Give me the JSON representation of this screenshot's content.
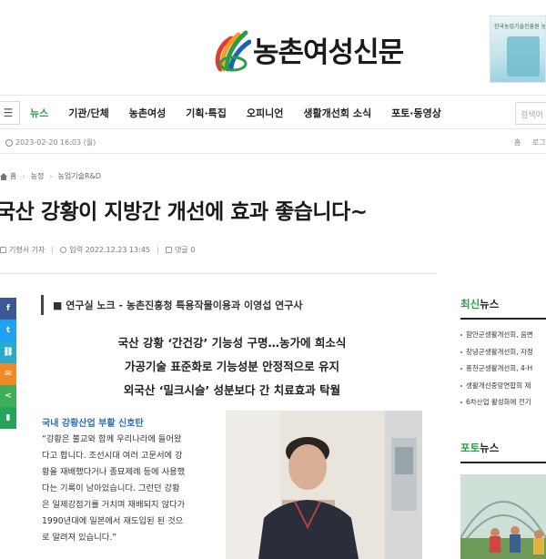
{
  "site": {
    "logo_text": "농촌여성신문"
  },
  "ad": {
    "text": "한국농업기술진흥원 농촌진흥"
  },
  "nav": {
    "menu_icon": "hamburger-icon",
    "items": [
      "뉴스",
      "기관/단체",
      "농촌여성",
      "기획·특집",
      "오피니언",
      "생활개선회 소식",
      "포토·동영상"
    ],
    "active": "뉴스",
    "search_placeholder": "검색어"
  },
  "datebar": {
    "date": "2023-02-20 16:03 (월)",
    "links": [
      "홈",
      "로그"
    ]
  },
  "breadcrumb": [
    "홈",
    "농정",
    "농업기술R&D"
  ],
  "article": {
    "headline": "국산 강황이 지방간 개선에 효과 좋습니다~",
    "reporter": "기형서 기자",
    "date": "입력 2022.12.23 13:45",
    "comments": "댓글 0",
    "subtitle": "■ 연구실 노크 - 농촌진흥청 특용작물이용과 이영섭 연구사",
    "leads": [
      "국산 강황 ‘간건강’ 기능성 구명…농가에 희소식",
      "가공기술 표준화로 기능성분 안정적으로 유지",
      "외국산 ‘밀크시슬’ 성분보다 간 치료효과 탁월"
    ],
    "section_heading": "국내 강황산업 부활 신호탄",
    "body_lines": [
      "“강황은 불교와 함께 우리나라에 들어왔",
      "다고 합니다. 조선시대 여러 고문서에 강",
      "황을 재배했다거나 종묘제례 등에 사용했",
      "다는 기록이 남아있습니다. 그런던 강황",
      "은 일제강점기를 거치며 재배되지 않다가",
      "1990년대에 일본에서 재도입된 된 것으",
      "로 알려져 있습니다.”"
    ]
  },
  "share": {
    "buttons": [
      {
        "icon": "facebook-icon",
        "glyph": "f",
        "color": "#3b5998"
      },
      {
        "icon": "twitter-icon",
        "glyph": "t",
        "color": "#1da1f2"
      },
      {
        "icon": "link-icon",
        "glyph": "⛓",
        "color": "#2aa9c9"
      },
      {
        "icon": "mail-icon",
        "glyph": "✉",
        "color": "#f08a24"
      },
      {
        "icon": "share-icon",
        "glyph": "<",
        "color": "#3fae5a"
      },
      {
        "icon": "bookmark-icon",
        "glyph": "▮",
        "color": "#27a35a"
      }
    ]
  },
  "sidebar": {
    "latest_title_accent": "최신",
    "latest_title_rest": "뉴스",
    "latest_items": [
      "함안군생활개선회, 음변",
      "창녕군생활개선회, 자정",
      "홍천군생활개선회, 4-H",
      "생활개선중앙연합회 제",
      "6차산업 활성화에 전기"
    ],
    "photo_title_accent": "포토",
    "photo_title_rest": "뉴스"
  }
}
